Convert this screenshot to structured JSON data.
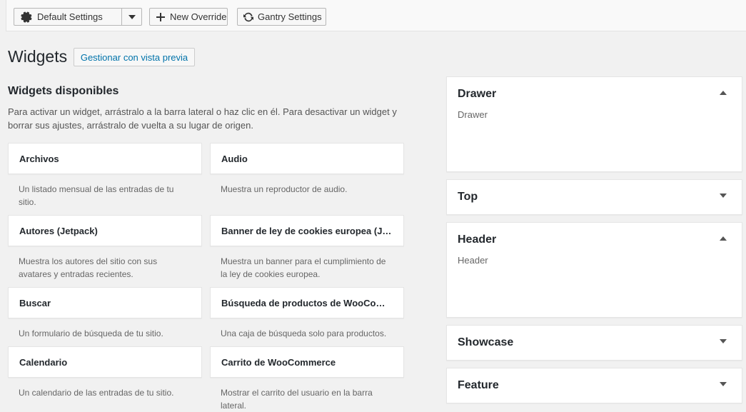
{
  "toolbar": {
    "select_label": "Default Settings",
    "new_override_label": "New Override",
    "gantry_settings_label": "Gantry Settings"
  },
  "header": {
    "title": "Widgets",
    "preview_button": "Gestionar con vista previa"
  },
  "available": {
    "title": "Widgets disponibles",
    "description": "Para activar un widget, arrástralo a la barra lateral o haz clic en él. Para desactivar un widget y borrar sus ajustes, arrástralo de vuelta a su lugar de origen.",
    "widgets": [
      {
        "name": "Archivos",
        "desc": "Un listado mensual de las entradas de tu sitio."
      },
      {
        "name": "Audio",
        "desc": "Muestra un reproductor de audio."
      },
      {
        "name": "Autores (Jetpack)",
        "desc": "Muestra los autores del sitio con sus avatares y entradas recientes."
      },
      {
        "name": "Banner de ley de cookies europea (Jet...",
        "desc": "Muestra un banner para el cumplimiento de la ley de cookies europea."
      },
      {
        "name": "Buscar",
        "desc": "Un formulario de búsqueda de tu sitio."
      },
      {
        "name": "Búsqueda de productos de WooComm...",
        "desc": "Una caja de búsqueda solo para productos."
      },
      {
        "name": "Calendario",
        "desc": "Un calendario de las entradas de tu sitio."
      },
      {
        "name": "Carrito de WooCommerce",
        "desc": "Mostrar el carrito del usuario en la barra lateral."
      }
    ]
  },
  "sidebars": [
    {
      "title": "Drawer",
      "desc": "Drawer",
      "expanded": true
    },
    {
      "title": "Top",
      "desc": "",
      "expanded": false
    },
    {
      "title": "Header",
      "desc": "Header",
      "expanded": true
    },
    {
      "title": "Showcase",
      "desc": "",
      "expanded": false
    },
    {
      "title": "Feature",
      "desc": "",
      "expanded": false
    }
  ],
  "colors": {
    "background": "#f1f1f1",
    "link": "#0073aa",
    "text": "#23282d"
  }
}
